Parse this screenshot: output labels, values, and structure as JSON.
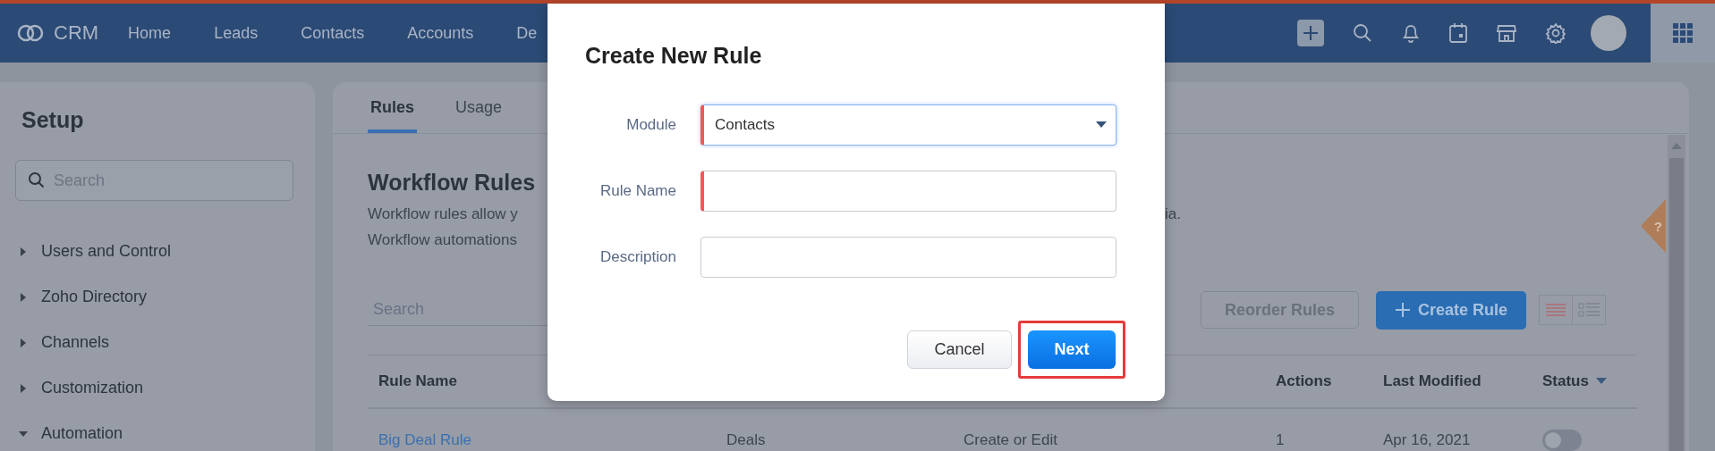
{
  "top_nav": {
    "logo": "CRM",
    "links": [
      "Home",
      "Leads",
      "Contacts",
      "Accounts",
      "De"
    ]
  },
  "sidebar": {
    "title": "Setup",
    "search": {
      "placeholder": "Search"
    },
    "items": [
      {
        "label": "Users and Control",
        "expanded": false
      },
      {
        "label": "Zoho Directory",
        "expanded": false
      },
      {
        "label": "Channels",
        "expanded": false
      },
      {
        "label": "Customization",
        "expanded": false
      },
      {
        "label": "Automation",
        "expanded": true
      }
    ]
  },
  "main": {
    "tabs": [
      {
        "label": "Rules",
        "selected": true
      },
      {
        "label": "Usage",
        "selected": false
      }
    ],
    "heading": "Workflow Rules",
    "description_left": [
      "Workflow rules allow y",
      "Workflow automations"
    ],
    "description_right": "ia.",
    "search": {
      "placeholder": "Search"
    },
    "reorder_button": "Reorder Rules",
    "create_button": "Create Rule",
    "view_toggle": [
      {
        "kind": "list"
      },
      {
        "kind": "detail"
      }
    ],
    "help_tab": "?",
    "table": {
      "columns": [
        "Rule Name",
        "Actions",
        "Last Modified",
        "Status"
      ],
      "rows": [
        {
          "rule_name": "Big Deal Rule",
          "column_2": "Deals",
          "column_3": "Create or Edit",
          "actions": "1",
          "last_modified": "Apr 16, 2021",
          "active": false
        }
      ]
    }
  },
  "dialog": {
    "title": "Create New Rule",
    "fields": [
      {
        "kind": "select",
        "label": "Module",
        "value": "Contacts",
        "required": true,
        "focused": true
      },
      {
        "kind": "text",
        "label": "Rule Name",
        "required": true,
        "focused": false
      },
      {
        "kind": "text",
        "label": "Description",
        "required": false,
        "focused": false
      }
    ],
    "cancel_button": "Cancel",
    "next_button": {
      "label": "Next",
      "highlighted": true
    }
  }
}
